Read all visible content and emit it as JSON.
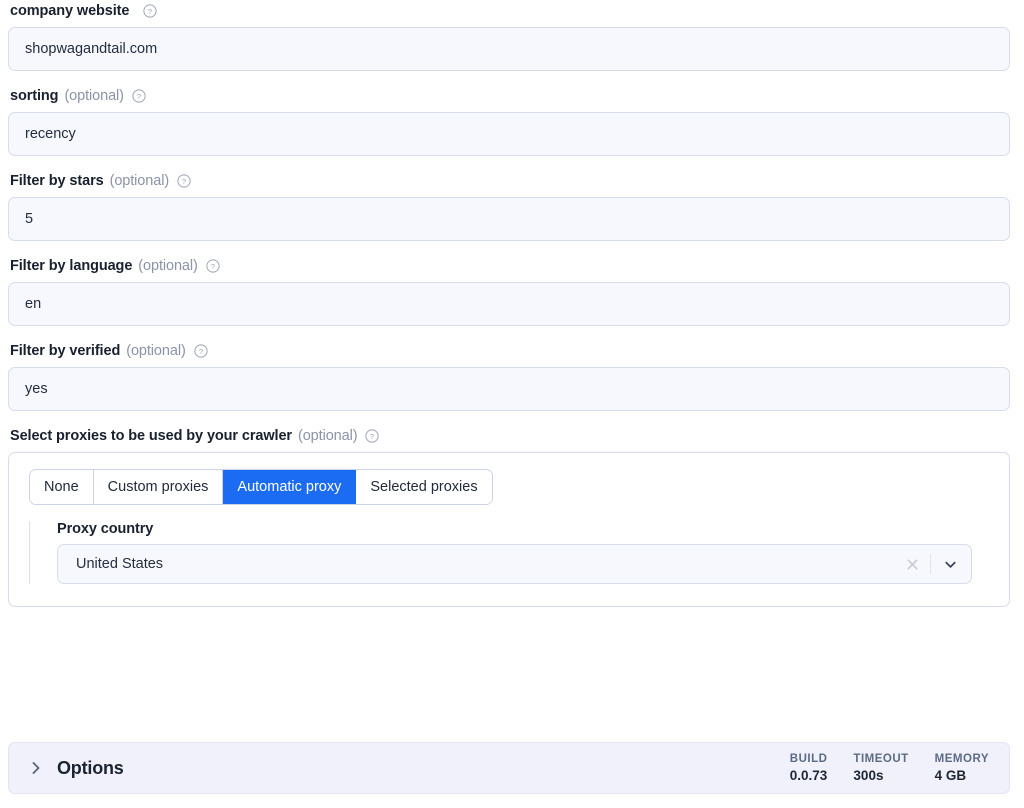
{
  "form": {
    "fields": [
      {
        "label": "company website",
        "optional": "",
        "help_icon": "help-circle-icon",
        "value": "shopwagandtail.com"
      },
      {
        "label": "sorting",
        "optional": "(optional)",
        "help_icon": "help-circle-icon",
        "value": "recency"
      },
      {
        "label": "Filter by stars",
        "optional": "(optional)",
        "help_icon": "help-circle-icon",
        "value": "5"
      },
      {
        "label": "Filter by language",
        "optional": "(optional)",
        "help_icon": "help-circle-icon",
        "value": "en"
      },
      {
        "label": "Filter by verified",
        "optional": "(optional)",
        "help_icon": "help-circle-icon",
        "value": "yes"
      }
    ]
  },
  "proxy": {
    "label": "Select proxies to be used by your crawler",
    "optional": "(optional)",
    "help_icon": "help-circle-icon",
    "tabs": [
      {
        "label": "None",
        "active": false
      },
      {
        "label": "Custom proxies",
        "active": false
      },
      {
        "label": "Automatic proxy",
        "active": true
      },
      {
        "label": "Selected proxies",
        "active": false
      }
    ],
    "country": {
      "label": "Proxy country",
      "value": "United States",
      "clear_icon": "close-icon",
      "dropdown_icon": "chevron-down-icon"
    }
  },
  "options": {
    "expand_icon": "chevron-right-icon",
    "title": "Options",
    "stats": [
      {
        "key": "BUILD",
        "value": "0.0.73"
      },
      {
        "key": "TIMEOUT",
        "value": "300s"
      },
      {
        "key": "MEMORY",
        "value": "4 GB"
      }
    ]
  },
  "colors": {
    "accent": "#1b6cf2",
    "input_bg": "#f6f8fd",
    "border": "#d7dced",
    "options_bg": "#f0f1fb",
    "muted_text": "#8b93a7"
  }
}
